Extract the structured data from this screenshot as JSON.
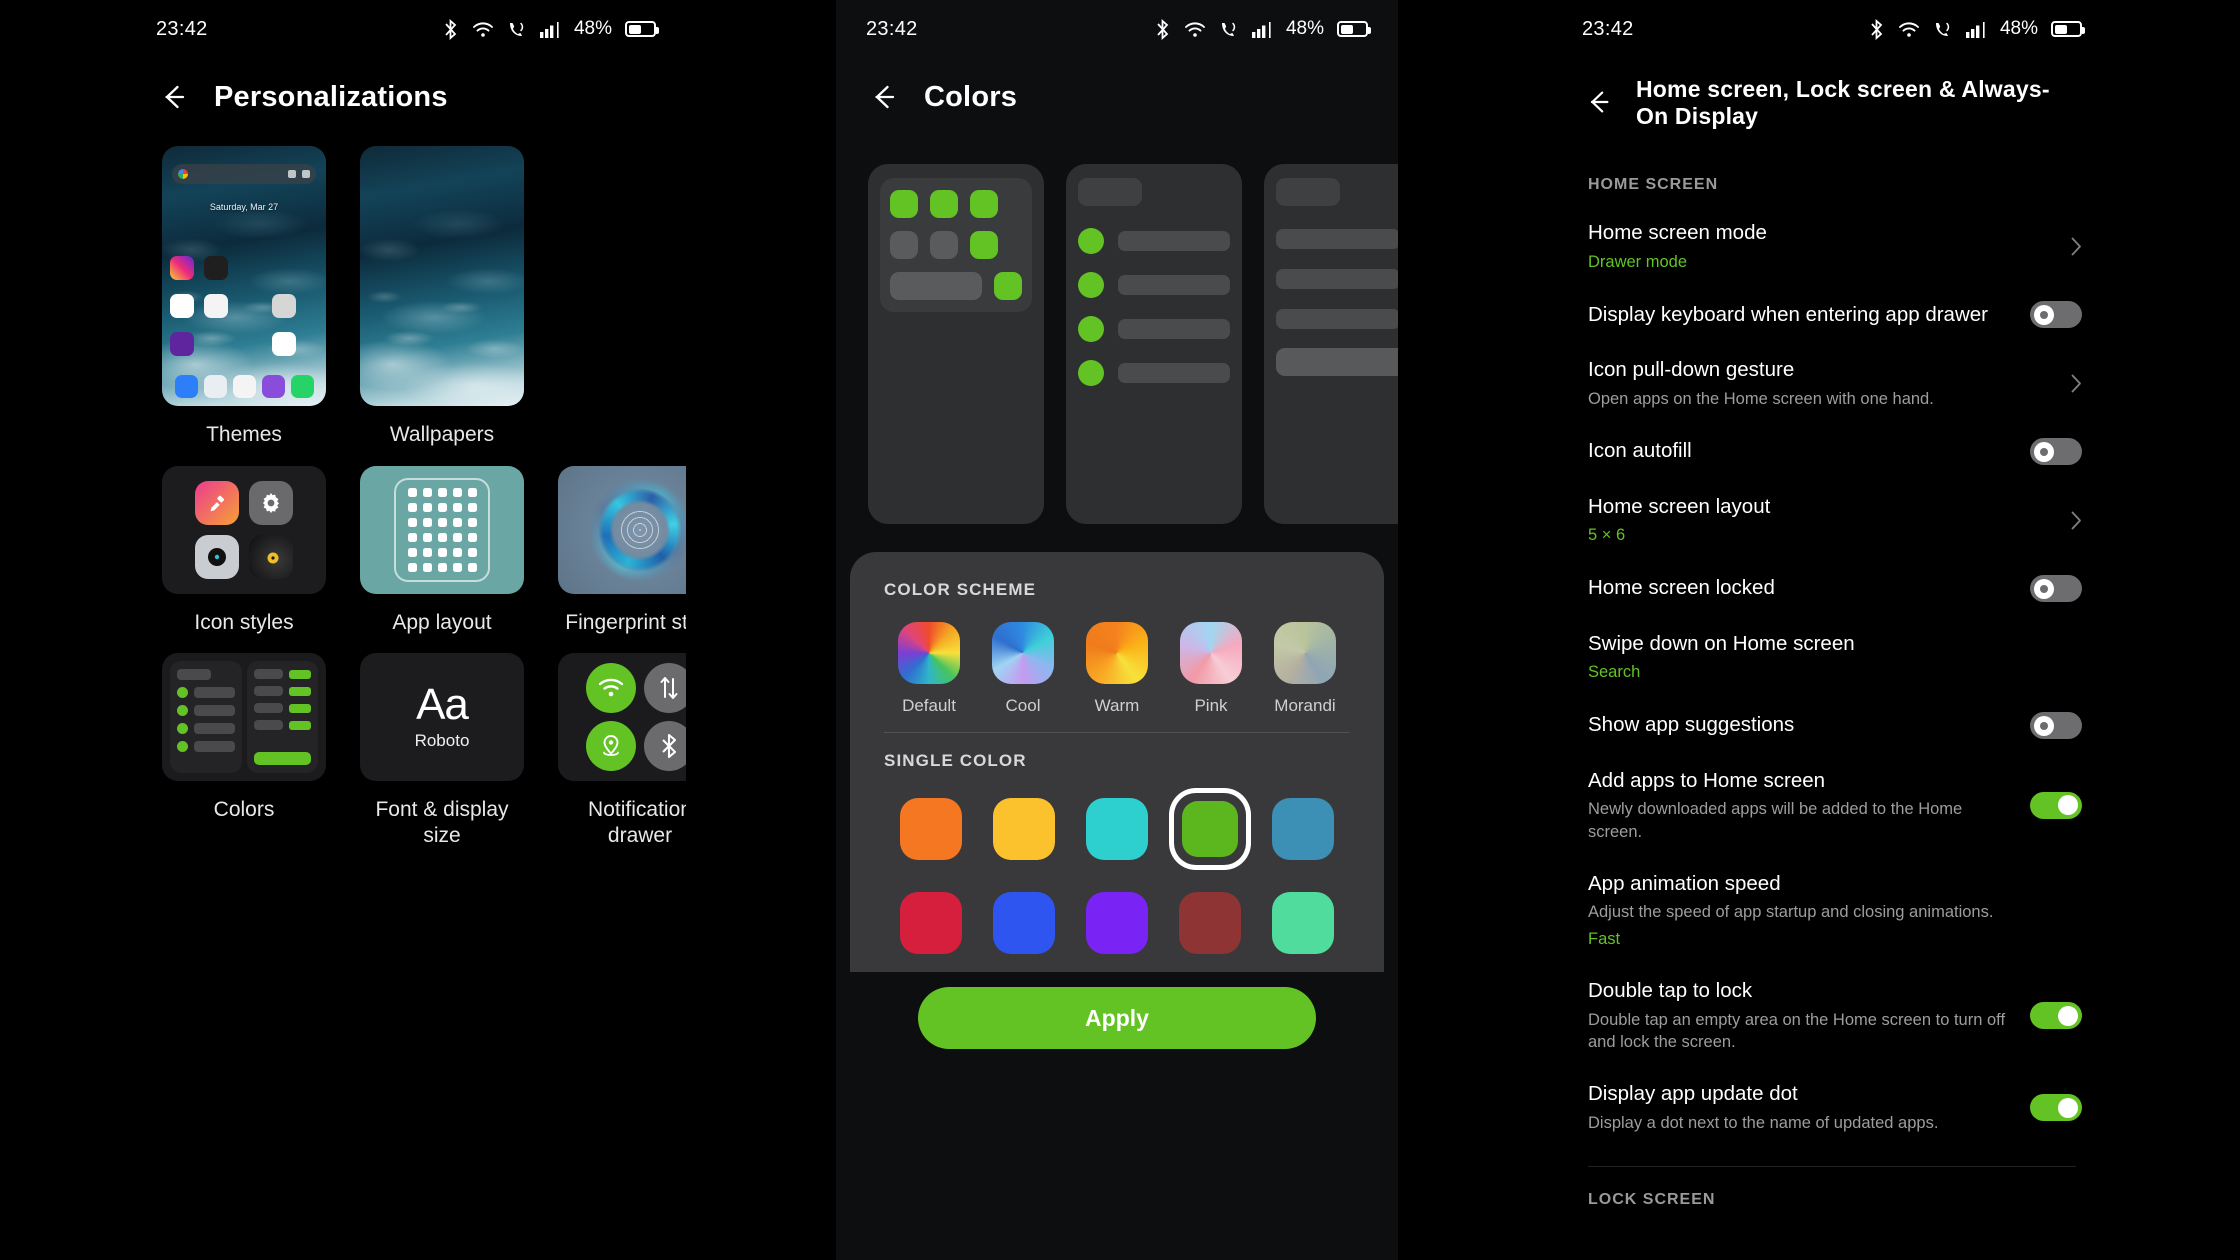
{
  "status_bar": {
    "time": "23:42",
    "battery_percent": "48%",
    "icons": [
      "bluetooth-icon",
      "wifi-icon",
      "volte-call-icon",
      "signal-bars-icon",
      "battery-icon"
    ]
  },
  "colors": {
    "accent_green": "#63c224",
    "panel_bg": "#39393b",
    "card_bg": "#2e2f31"
  },
  "panel1": {
    "title": "Personalizations",
    "tiles": [
      {
        "label": "Themes"
      },
      {
        "label": "Wallpapers"
      },
      {
        "label": "Icon styles"
      },
      {
        "label": "App layout"
      },
      {
        "label": "Fingerprint style"
      },
      {
        "label": "Colors"
      },
      {
        "label": "Font & display size"
      },
      {
        "label": "Notification drawer"
      }
    ],
    "home_preview": {
      "date": "Saturday, Mar 27",
      "search_hint": "google-search-bar"
    },
    "font_tile": {
      "sample": "Aa",
      "font_name": "Roboto"
    },
    "notification_tile_icons": [
      "wifi-icon",
      "data-transfer-icon",
      "location-icon",
      "bluetooth-icon"
    ]
  },
  "panel2": {
    "title": "Colors",
    "color_scheme": {
      "heading": "COLOR SCHEME",
      "options": [
        {
          "label": "Default",
          "selected": false
        },
        {
          "label": "Cool",
          "selected": false
        },
        {
          "label": "Warm",
          "selected": false
        },
        {
          "label": "Pink",
          "selected": false
        },
        {
          "label": "Morandi",
          "selected": false
        }
      ]
    },
    "single_color": {
      "heading": "SINGLE COLOR",
      "swatches": [
        {
          "name": "orange",
          "hex": "#f57722",
          "selected": false
        },
        {
          "name": "amber",
          "hex": "#fcc22d",
          "selected": false
        },
        {
          "name": "cyan",
          "hex": "#2ed0cf",
          "selected": false
        },
        {
          "name": "green",
          "hex": "#5cb71f",
          "selected": true
        },
        {
          "name": "steel-blue",
          "hex": "#3c8fb5",
          "selected": false
        },
        {
          "name": "crimson",
          "hex": "#d61f3c",
          "selected": false
        },
        {
          "name": "blue",
          "hex": "#2f55f0",
          "selected": false
        },
        {
          "name": "violet",
          "hex": "#7a23f5",
          "selected": false
        },
        {
          "name": "brick",
          "hex": "#8e3434",
          "selected": false
        },
        {
          "name": "mint",
          "hex": "#4fdc9d",
          "selected": false
        }
      ]
    },
    "apply_button": "Apply"
  },
  "panel3": {
    "title": "Home screen, Lock screen & Always-On Display",
    "section_home": "HOME SCREEN",
    "section_lock": "LOCK SCREEN",
    "items": [
      {
        "title": "Home screen mode",
        "value": "Drawer mode",
        "control": "chevron"
      },
      {
        "title": "Display keyboard when entering app drawer",
        "control": "toggle",
        "on": false
      },
      {
        "title": "Icon pull-down gesture",
        "sub": "Open apps on the Home screen with one hand.",
        "control": "chevron"
      },
      {
        "title": "Icon autofill",
        "control": "toggle",
        "on": false
      },
      {
        "title": "Home screen layout",
        "value": "5 × 6",
        "control": "chevron"
      },
      {
        "title": "Home screen locked",
        "control": "toggle",
        "on": false
      },
      {
        "title": "Swipe down on Home screen",
        "value": "Search",
        "control": "none"
      },
      {
        "title": "Show app suggestions",
        "control": "toggle",
        "on": false
      },
      {
        "title": "Add apps to Home screen",
        "sub": "Newly downloaded apps will be added to the Home screen.",
        "control": "toggle",
        "on": true
      },
      {
        "title": "App animation speed",
        "sub": "Adjust the speed of app startup and closing animations.",
        "value": "Fast",
        "control": "none"
      },
      {
        "title": "Double tap to lock",
        "sub": "Double tap an empty area on the Home screen to turn off and lock the screen.",
        "control": "toggle",
        "on": true
      },
      {
        "title": "Display app update dot",
        "sub": "Display a dot next to the name of updated apps.",
        "control": "toggle",
        "on": true
      }
    ]
  }
}
